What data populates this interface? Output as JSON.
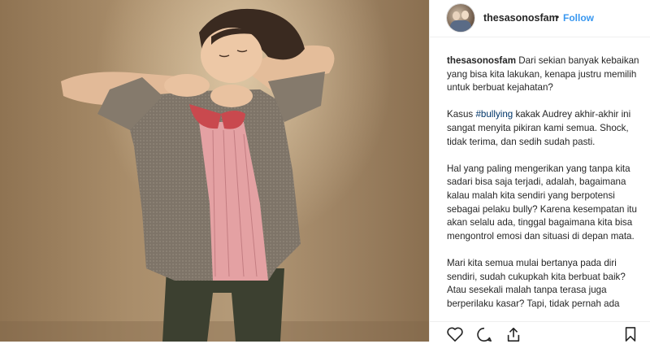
{
  "post": {
    "username": "thesasonosfam",
    "separator": "•",
    "follow_label": "Follow",
    "caption_paragraphs": [
      {
        "lead": "Dari sekian banyak kebaikan yang bisa kita lakukan, kenapa justru memilih untuk berbuat kejahatan?"
      },
      {
        "pre": "Kasus ",
        "hashtag": "#bullying",
        "post": " kakak Audrey akhir-akhir ini sangat menyita pikiran kami semua. Shock, tidak terima, dan sedih sudah pasti."
      },
      {
        "text": "Hal yang paling mengerikan yang tanpa kita sadari bisa saja terjadi, adalah, bagaimana kalau malah kita sendiri yang berpotensi sebagai pelaku bully? Karena kesempatan itu akan selalu ada, tinggal bagaimana kita bisa mengontrol emosi dan situasi di depan mata."
      },
      {
        "text": "Mari kita semua mulai bertanya pada diri sendiri, sudah cukupkah kita berbuat baik? Atau sesekali malah tanpa terasa juga berperilaku kasar? Tapi, tidak pernah ada"
      }
    ]
  },
  "icons": {
    "like": "heart-outline",
    "comment": "speech-bubble",
    "share": "share-arrow",
    "save": "bookmark"
  },
  "colors": {
    "follow": "#3897f0",
    "hashtag": "#003569",
    "text": "#262626"
  }
}
